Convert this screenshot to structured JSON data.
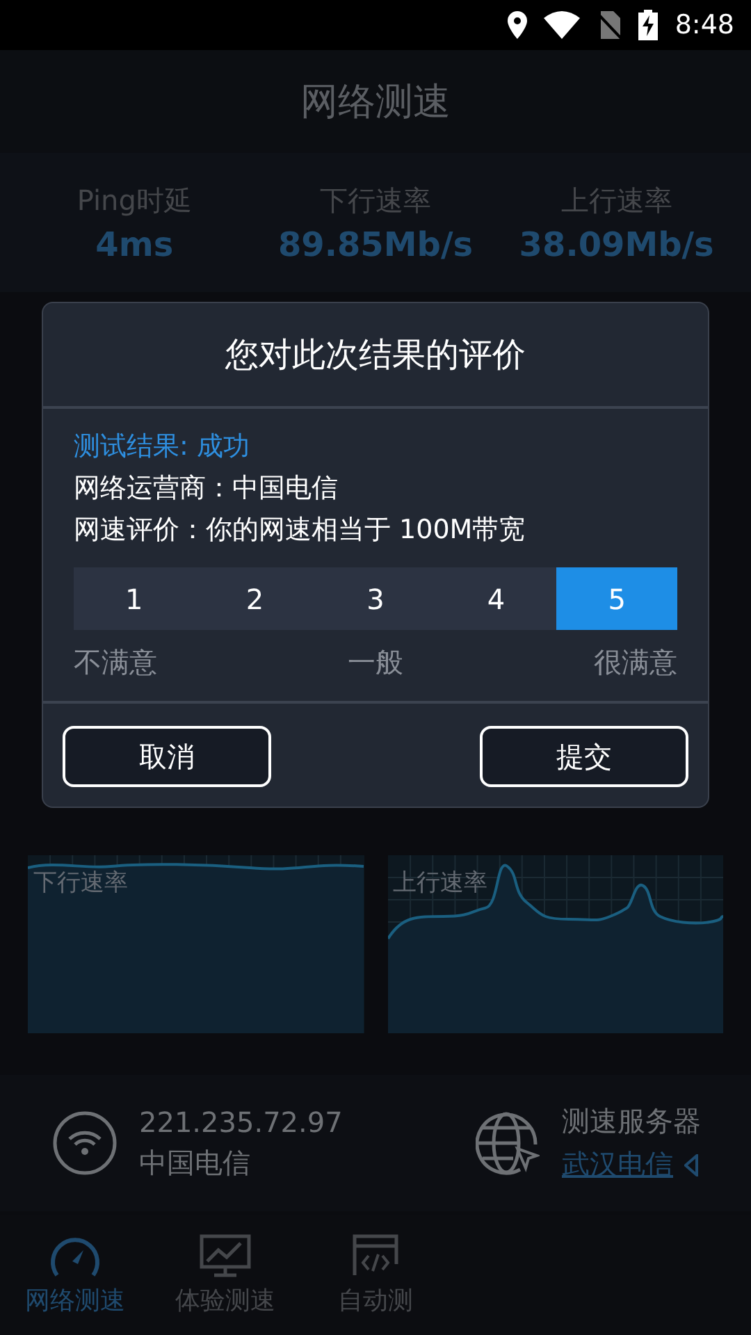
{
  "status_bar": {
    "time": "8:48"
  },
  "header": {
    "title": "网络测速"
  },
  "stats": [
    {
      "label": "Ping时延",
      "value": "4ms"
    },
    {
      "label": "下行速率",
      "value": "89.85Mb/s"
    },
    {
      "label": "上行速率",
      "value": "38.09Mb/s"
    }
  ],
  "dialog": {
    "title": "您对此次结果的评价",
    "result": "测试结果: 成功",
    "lines": [
      "网络运营商：中国电信",
      "网速评价：你的网速相当于 100M带宽"
    ],
    "ratings": [
      {
        "label": "1",
        "selected": false
      },
      {
        "label": "2",
        "selected": false
      },
      {
        "label": "3",
        "selected": false
      },
      {
        "label": "4",
        "selected": false
      },
      {
        "label": "5",
        "selected": true
      }
    ],
    "scale_labels": [
      "不满意",
      "一般",
      "很满意"
    ],
    "buttons": [
      "取消",
      "提交"
    ]
  },
  "charts": [
    {
      "label": "下行速率",
      "kind": "flat"
    },
    {
      "label": "上行速率",
      "kind": "peaks"
    }
  ],
  "info": {
    "ip": "221.235.72.97",
    "isp": "中国电信",
    "server_label": "测速服务器",
    "server": "武汉电信"
  },
  "nav": [
    {
      "label": "网络测速",
      "selected": true
    },
    {
      "label": "体验测速",
      "selected": false
    },
    {
      "label": "自动测",
      "selected": false
    }
  ]
}
